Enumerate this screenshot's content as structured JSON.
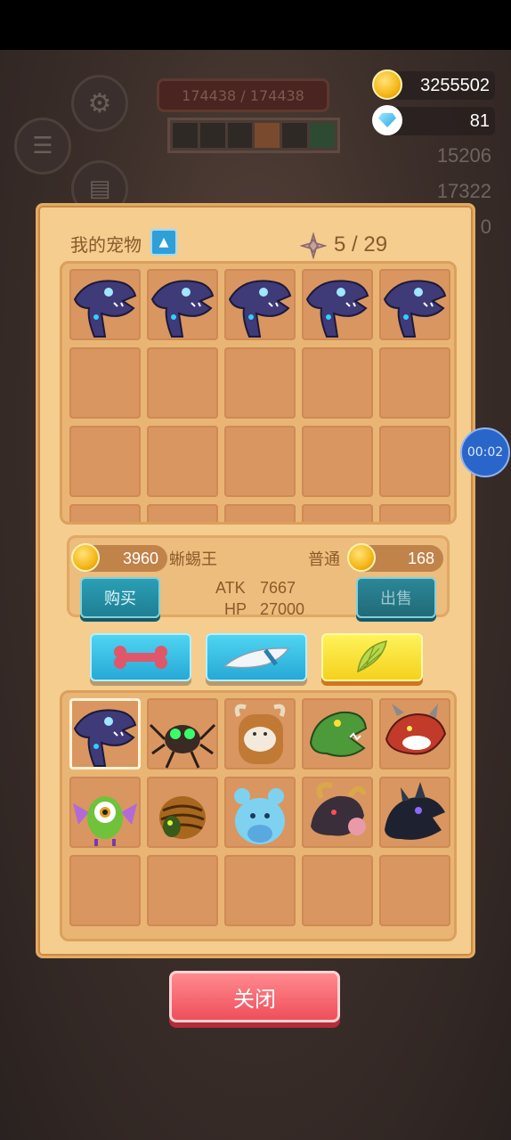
{
  "background": {
    "settings_label": "设置",
    "tasks_label": "任务",
    "hp_text": "174438 / 174438",
    "gold": "3255502",
    "gems": "81",
    "stat1": "15206",
    "stat2": "17322",
    "stat3": "0",
    "timer": "00:02"
  },
  "panel": {
    "title": "我的宠物",
    "sort_icon": "triangle-up",
    "capacity": "5 / 29",
    "owned_pets": [
      "raptor-purple",
      "raptor-purple",
      "raptor-purple",
      "raptor-purple",
      "raptor-purple"
    ],
    "owned_rows": 4
  },
  "selected_pet": {
    "buy_price": "3960",
    "name": "蜥蜴王",
    "rarity": "普通",
    "sell_price": "168",
    "atk_label": "ATK",
    "atk": "7667",
    "hp_label": "HP",
    "hp": "27000",
    "buy_label": "购买",
    "sell_label": "出售"
  },
  "categories": [
    {
      "icon": "bone-icon",
      "color": "blue",
      "active": false
    },
    {
      "icon": "fang-icon",
      "color": "blue",
      "active": false
    },
    {
      "icon": "wing-icon",
      "color": "yellow",
      "active": true
    }
  ],
  "shop_pets": [
    "raptor-purple",
    "spider",
    "beast-bull",
    "crocodile-green",
    "dragon-red",
    "eyeball-bat",
    "beetle",
    "blue-blob",
    "horned-dragon",
    "shadow-dragon"
  ],
  "shop_rows": 3,
  "close_label": "关闭",
  "colors": {
    "panel": "#f4cd8f",
    "cell": "#d99660",
    "close": "#ef4f5b",
    "teal": "#1f7f93"
  }
}
